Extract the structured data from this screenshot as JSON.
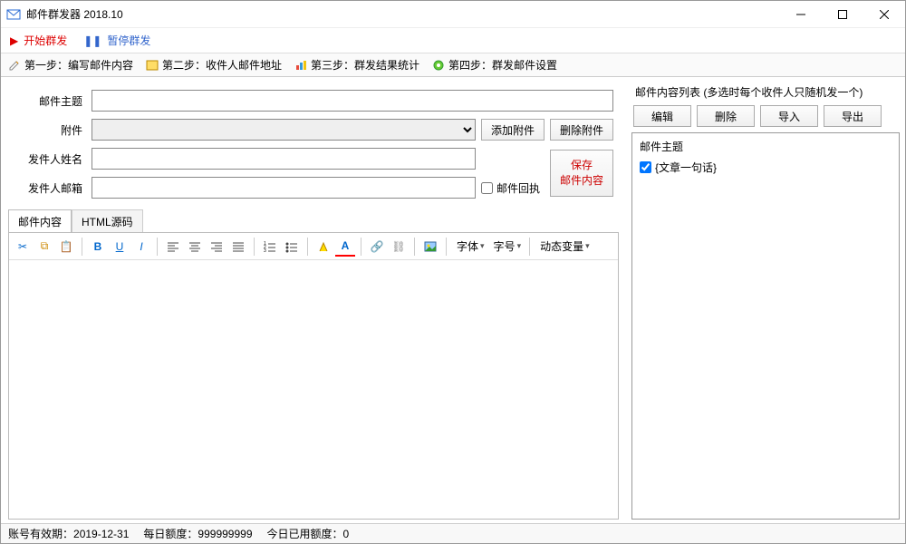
{
  "window": {
    "title": "邮件群发器 2018.10"
  },
  "toolbar": {
    "start": "开始群发",
    "pause": "暂停群发"
  },
  "steps": {
    "s1": "第一步：编写邮件内容",
    "s2": "第二步：收件人邮件地址",
    "s3": "第三步：群发结果统计",
    "s4": "第四步：群发邮件设置"
  },
  "form": {
    "subject_label": "邮件主题",
    "subject_value": "",
    "attach_label": "附件",
    "attach_value": "",
    "add_attach": "添加附件",
    "del_attach": "删除附件",
    "sender_name_label": "发件人姓名",
    "sender_name_value": "",
    "sender_email_label": "发件人邮箱",
    "sender_email_value": "",
    "receipt_label": "邮件回执",
    "save_line1": "保存",
    "save_line2": "邮件内容"
  },
  "editor": {
    "tab_content": "邮件内容",
    "tab_html": "HTML源码",
    "font_label": "字体",
    "size_label": "字号",
    "dyn_label": "动态变量"
  },
  "right": {
    "title": "邮件内容列表 (多选时每个收件人只随机发一个)",
    "btn_edit": "编辑",
    "btn_delete": "删除",
    "btn_import": "导入",
    "btn_export": "导出",
    "header": "邮件主题",
    "items": [
      {
        "checked": true,
        "label": "{文章一句话}"
      }
    ]
  },
  "status": {
    "valid_label": "账号有效期：",
    "valid_value": "2019-12-31",
    "quota_label": "每日额度：",
    "quota_value": "999999999",
    "used_label": "今日已用额度：",
    "used_value": "0"
  }
}
